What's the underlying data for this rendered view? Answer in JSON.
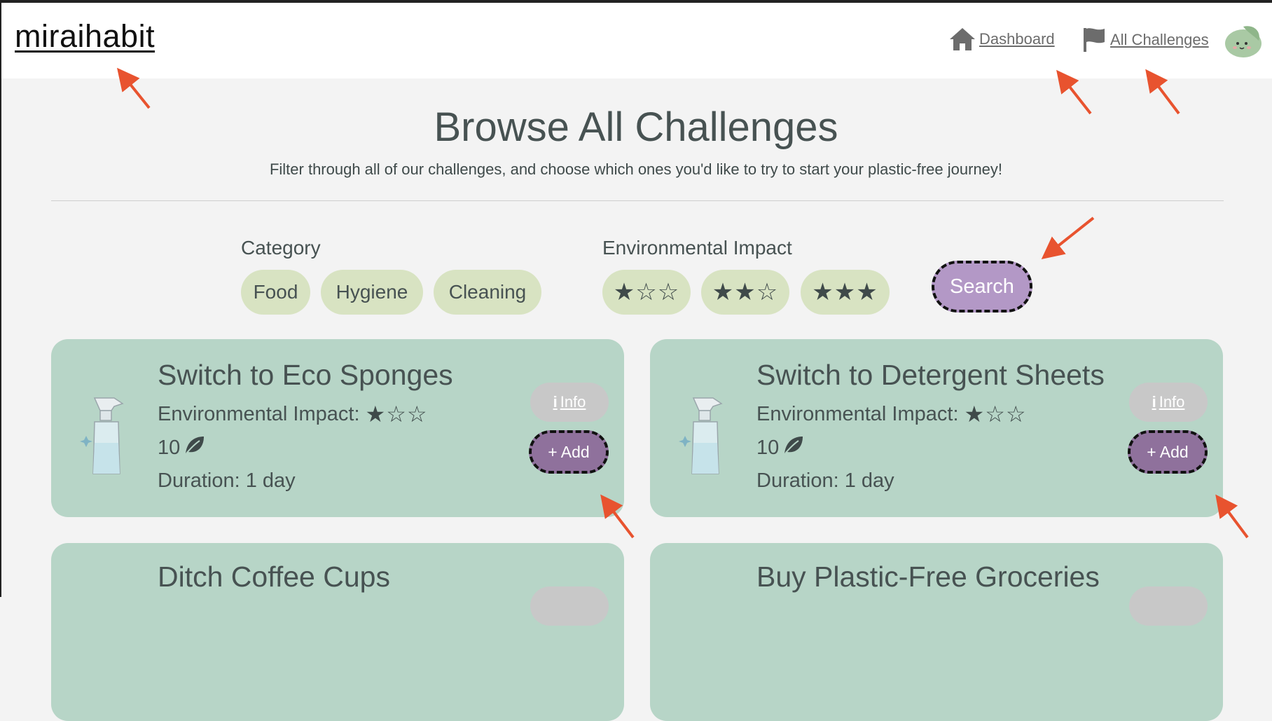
{
  "header": {
    "logo": "miraihabit",
    "nav": [
      {
        "label": "Dashboard",
        "icon": "home-icon"
      },
      {
        "label": "All Challenges",
        "icon": "flag-icon"
      }
    ],
    "avatar_icon": "leaf-creature-avatar"
  },
  "page": {
    "title": "Browse All Challenges",
    "subtitle": "Filter through all of our challenges, and choose which ones you'd like to try to start your plastic-free journey!"
  },
  "filters": {
    "category_label": "Category",
    "categories": [
      "Food",
      "Hygiene",
      "Cleaning"
    ],
    "impact_label": "Environmental Impact",
    "impact_levels": [
      "★☆☆",
      "★★☆",
      "★★★"
    ],
    "search_label": "Search"
  },
  "cards": [
    {
      "title": "Switch to Eco Sponges",
      "impact_label": "Environmental Impact:",
      "impact_stars": "★☆☆",
      "points": "10",
      "duration": "Duration: 1 day",
      "info_label": "Info",
      "add_label": "+ Add",
      "image": "spray-bottle-icon"
    },
    {
      "title": "Switch to Detergent Sheets",
      "impact_label": "Environmental Impact:",
      "impact_stars": "★☆☆",
      "points": "10",
      "duration": "Duration: 1 day",
      "info_label": "Info",
      "add_label": "+ Add",
      "image": "spray-bottle-icon"
    },
    {
      "title": "Ditch Coffee Cups"
    },
    {
      "title": "Buy Plastic-Free Groceries"
    }
  ],
  "colors": {
    "accent_purple": "#b398c6",
    "add_purple": "#8f719c",
    "card_green": "#b7d5c7",
    "chip_green": "#d8e3c2",
    "annotation_arrow": "#e8532f"
  }
}
